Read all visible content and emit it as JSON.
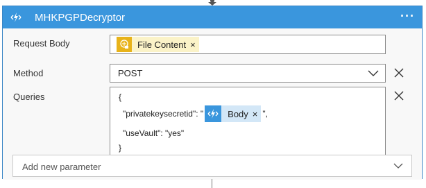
{
  "action": {
    "title": "MHKPGPDecryptor",
    "more_label": "···",
    "icon": "azure-function-icon",
    "accent": "#3a96dd"
  },
  "fields": {
    "request_body": {
      "label": "Request Body",
      "token": {
        "label": "File Content",
        "icon": "sftp-connector-icon",
        "color": "#fbf3c8",
        "icon_bg": "#e8b31a"
      }
    },
    "method": {
      "label": "Method",
      "value": "POST"
    },
    "queries": {
      "label": "Queries",
      "line1": "{",
      "line2_prefix": "\"privatekeysecretid\": \"",
      "token": {
        "label": "Body",
        "icon": "azure-function-icon",
        "color": "#d3e7f7",
        "icon_bg": "#3a96dd"
      },
      "line2_suffix": "\",",
      "line3": "\"useVault\": \"yes\"",
      "line4": "}"
    }
  },
  "add_parameter": {
    "placeholder": "Add new parameter"
  },
  "token_remove_glyph": "×"
}
